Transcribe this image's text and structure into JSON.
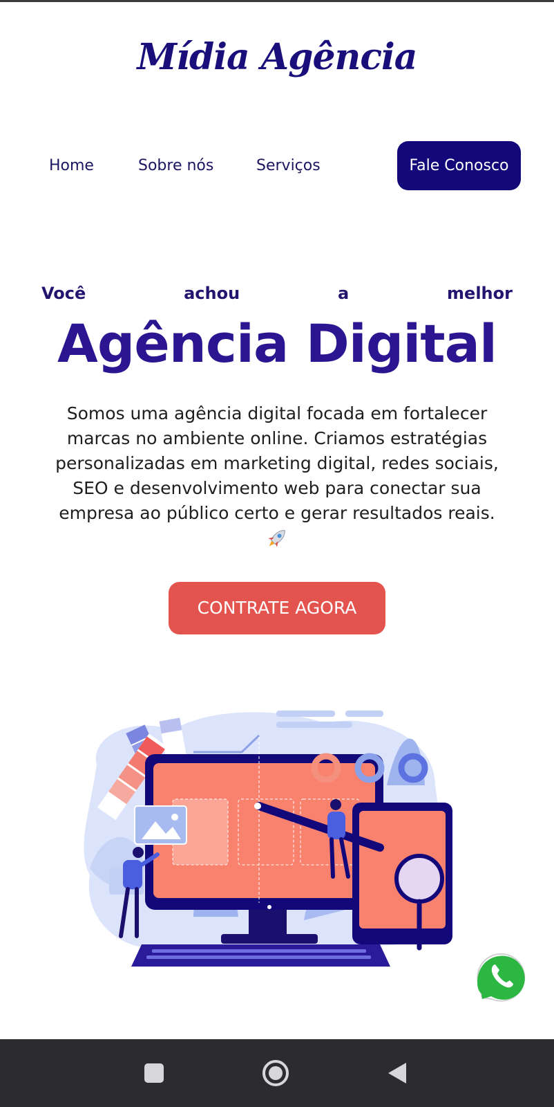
{
  "brand": {
    "logo_text": "Mídia Agência"
  },
  "nav": {
    "home": "Home",
    "sobre": "Sobre nós",
    "servicos": "Serviços",
    "cta": "Fale Conosco"
  },
  "hero": {
    "eyebrow_words": [
      "Você",
      "achou",
      "a",
      "melhor"
    ],
    "title": "Agência Digital",
    "description": "Somos uma agência digital focada em fortalecer marcas no ambiente online. Criamos estratégias personalizadas em marketing digital, redes sociais, SEO e desenvolvimento web para conectar sua empresa ao público certo e gerar resultados reais.",
    "cta": "CONTRATE AGORA"
  },
  "illustration": {
    "icon": "digital-agency-illustration"
  },
  "floating": {
    "icon": "whatsapp-icon",
    "color": "#2cb742"
  },
  "colors": {
    "brand_dark": "#13087a",
    "accent": "#e3544f",
    "headline": "#2c1591"
  },
  "system_nav": {
    "icons": [
      "recents-icon",
      "home-icon",
      "back-icon"
    ]
  }
}
